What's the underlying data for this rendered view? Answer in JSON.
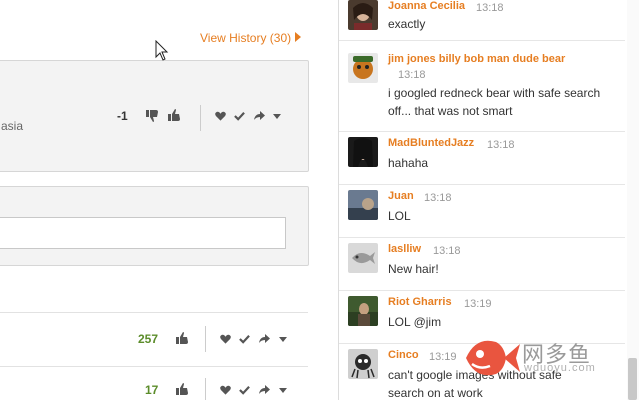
{
  "main": {
    "view_history_label": "View History (30)",
    "card": {
      "fragment_text": "asia",
      "vote_count": "-1"
    },
    "reply_input": {
      "value": "",
      "placeholder": ""
    },
    "comments": [
      {
        "likes": "257"
      },
      {
        "likes": "17"
      }
    ]
  },
  "chat": {
    "messages": [
      {
        "user": "Joanna Cecilia",
        "time": "13:18",
        "text": "exactly"
      },
      {
        "user": "jim jones billy bob man dude bear",
        "time": "13:18",
        "text": "i googled redneck bear with safe search off... that was not smart"
      },
      {
        "user": "MadBluntedJazz",
        "time": "13:18",
        "text": "hahaha"
      },
      {
        "user": "Juan",
        "time": "13:18",
        "text": "LOL"
      },
      {
        "user": "laslliw",
        "time": "13:18",
        "text": "New hair!"
      },
      {
        "user": "Riot Gharris",
        "time": "13:19",
        "text": "LOL @jim"
      },
      {
        "user": "Cinco",
        "time": "13:19",
        "text": "can't google images without safe search on at work"
      }
    ]
  },
  "watermark": {
    "cn": "网多鱼",
    "en": "wduoyu.com"
  },
  "colors": {
    "accent": "#e67e22",
    "positive": "#5b8c2a",
    "border": "#d6d6d6"
  }
}
